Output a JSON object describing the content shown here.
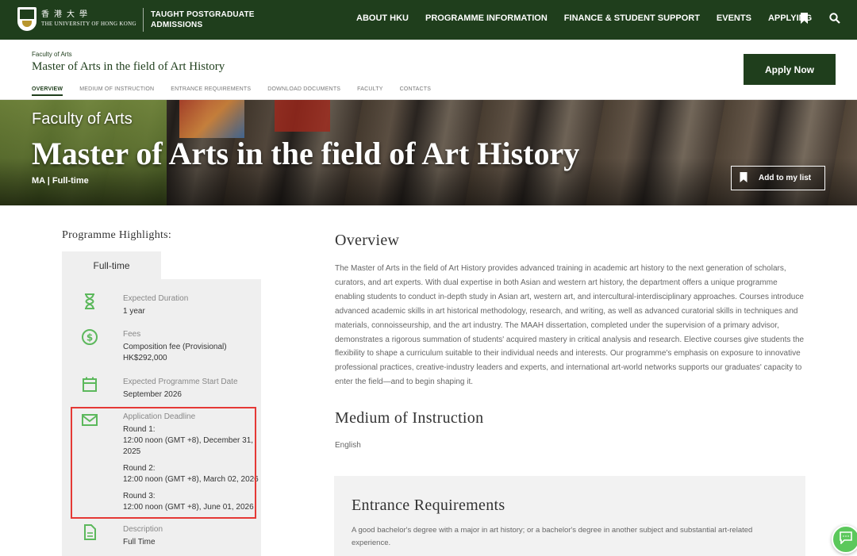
{
  "nav": {
    "logo_cn": "香港大學",
    "logo_en": "THE UNIVERSITY OF HONG KONG",
    "section_line1": "TAUGHT POSTGRADUATE",
    "section_line2": "ADMISSIONS",
    "items": [
      "ABOUT HKU",
      "PROGRAMME INFORMATION",
      "FINANCE & STUDENT SUPPORT",
      "EVENTS",
      "APPLYING"
    ],
    "bookmark_icon": "bookmark-icon",
    "search_icon": "search-icon"
  },
  "subheader": {
    "faculty": "Faculty of Arts",
    "title": "Master of Arts in the field of Art History",
    "tabs": [
      "OVERVIEW",
      "MEDIUM OF INSTRUCTION",
      "ENTRANCE REQUIREMENTS",
      "DOWNLOAD DOCUMENTS",
      "FACULTY",
      "CONTACTS"
    ],
    "active_tab": "OVERVIEW",
    "apply_label": "Apply Now"
  },
  "hero": {
    "faculty": "Faculty of Arts",
    "title": "Master of Arts in the field of Art History",
    "mode": "MA | Full-time",
    "mylist_label": "Add to my list"
  },
  "highlights": {
    "title": "Programme Highlights:",
    "tab": "Full-time",
    "duration_label": "Expected Duration",
    "duration_value": "1 year",
    "fees_label": "Fees",
    "fees_line1": "Composition fee (Provisional)",
    "fees_line2": "HK$292,000",
    "start_label": "Expected Programme Start Date",
    "start_value": "September 2026",
    "deadline_label": "Application Deadline",
    "round1_title": "Round 1:",
    "round1_line1": "12:00 noon (GMT +8), December 31,",
    "round1_line2": "2025",
    "round2_title": "Round 2:",
    "round2_value": "12:00 noon (GMT +8), March 02, 2026",
    "round3_title": "Round 3:",
    "round3_value": "12:00 noon (GMT +8), June 01, 2026",
    "desc_label": "Description",
    "desc_value": "Full Time"
  },
  "overview": {
    "heading": "Overview",
    "body": "The Master of Arts in the field of Art History provides advanced training in academic art history to the next generation of scholars, curators, and art experts. With dual expertise in both Asian and western art history, the department offers a unique programme enabling students to conduct in-depth study in Asian art, western art, and intercultural-interdisciplinary approaches. Courses introduce advanced academic skills in art historical methodology, research, and writing, as well as advanced curatorial skills in techniques and materials, connoisseurship, and the art industry. The MAAH dissertation, completed under the supervision of a primary advisor, demonstrates a rigorous summation of students' acquired mastery in critical analysis and research. Elective courses give students the flexibility to shape a curriculum suitable to their individual needs and interests. Our programme's emphasis on exposure to innovative professional practices, creative-industry leaders and experts, and international art-world networks supports our graduates' capacity to enter the field—and to begin shaping it."
  },
  "medium": {
    "heading": "Medium of Instruction",
    "value": "English"
  },
  "entrance": {
    "heading": "Entrance Requirements",
    "body": "A good bachelor's degree with a major in art history; or a bachelor's degree in another subject and substantial art-related experience."
  },
  "colors": {
    "brand_green": "#1f3e1c",
    "icon_green": "#5cb85c",
    "highlight_red": "#e53935"
  }
}
